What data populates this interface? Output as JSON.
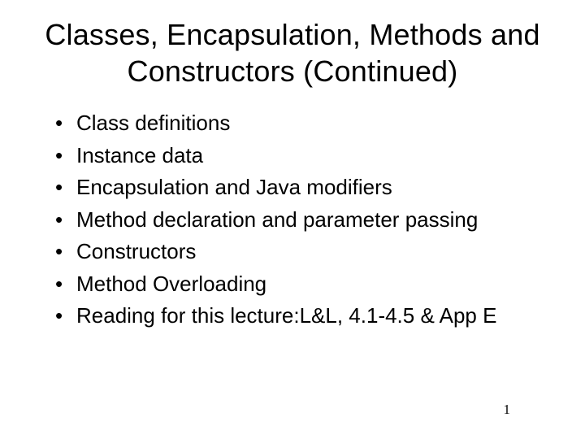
{
  "slide": {
    "title": "Classes, Encapsulation, Methods and Constructors (Continued)",
    "bullets": [
      "Class definitions",
      "Instance data",
      "Encapsulation and Java modifiers",
      "Method declaration and parameter passing",
      "Constructors",
      "Method Overloading",
      "Reading for this lecture:L&L, 4.1-4.5 & App E"
    ],
    "page_number": "1"
  }
}
